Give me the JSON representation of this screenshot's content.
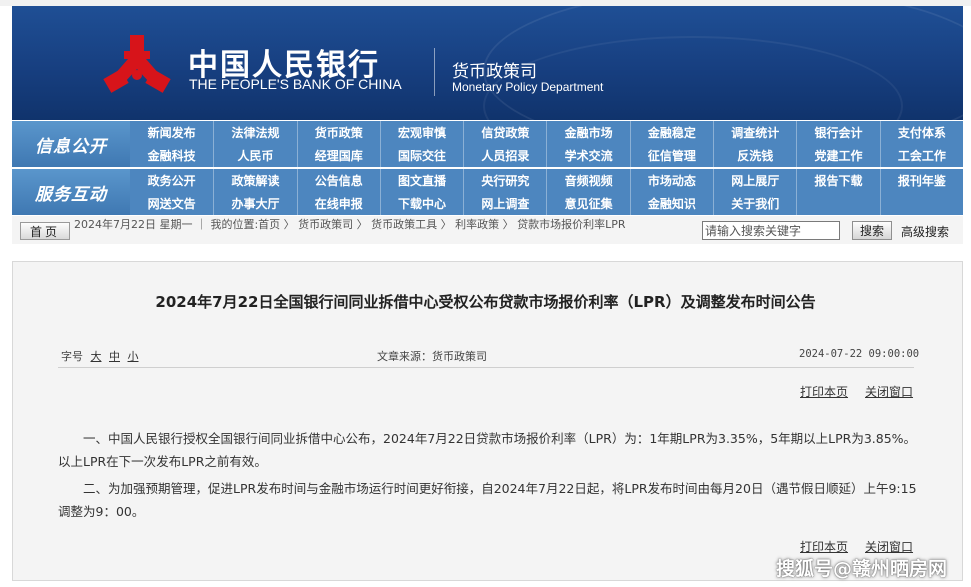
{
  "banner": {
    "bank_name_cn": "中国人民银行",
    "bank_name_en": "THE PEOPLE'S BANK OF CHINA",
    "dept_cn": "货币政策司",
    "dept_en": "Monetary Policy Department"
  },
  "nav": {
    "row1": {
      "label": "信息公开",
      "items": [
        "新闻发布",
        "法律法规",
        "货币政策",
        "宏观审慎",
        "信贷政策",
        "金融市场",
        "金融稳定",
        "调查统计",
        "银行会计",
        "支付体系",
        "金融科技",
        "人民币",
        "经理国库",
        "国际交往",
        "人员招录",
        "学术交流",
        "征信管理",
        "反洗钱",
        "党建工作",
        "工会工作"
      ]
    },
    "row2": {
      "label": "服务互动",
      "items": [
        "政务公开",
        "政策解读",
        "公告信息",
        "图文直播",
        "央行研究",
        "音频视频",
        "市场动态",
        "网上展厅",
        "报告下载",
        "报刊年鉴",
        "网送文告",
        "办事大厅",
        "在线申报",
        "下载中心",
        "网上调查",
        "意见征集",
        "金融知识",
        "关于我们",
        "",
        ""
      ]
    }
  },
  "breadcrumb": {
    "home_label": "首页",
    "text": "2024年7月22日 星期一 ｜ 我的位置:首页 〉 货币政策司 〉 货币政策工具 〉 利率政策 〉 贷款市场报价利率LPR"
  },
  "search": {
    "placeholder": "请输入搜索关键字",
    "button_label": "搜索",
    "advanced_label": "高级搜索"
  },
  "article": {
    "title": "2024年7月22日全国银行间同业拆借中心受权公布贷款市场报价利率（LPR）及调整发布时间公告",
    "font_size_label": "字号",
    "font_large": "大",
    "font_medium": "中",
    "font_small": "小",
    "source": "文章来源：货币政策司",
    "date": "2024-07-22 09:00:00",
    "print_label": "打印本页",
    "close_label": "关闭窗口",
    "paragraphs": [
      "一、中国人民银行授权全国银行间同业拆借中心公布，2024年7月22日贷款市场报价利率（LPR）为：1年期LPR为3.35%，5年期以上LPR为3.85%。以上LPR在下一次发布LPR之前有效。",
      "二、为加强预期管理，促进LPR发布时间与金融市场运行时间更好衔接，自2024年7月22日起，将LPR发布时间由每月20日（遇节假日顺延）上午9:15调整为9：00。"
    ]
  },
  "watermark": "搜狐号@赣州晒房网",
  "colors": {
    "banner_blue": "#173f80",
    "nav_blue": "#4d86bf",
    "logo_red": "#d7141a"
  }
}
